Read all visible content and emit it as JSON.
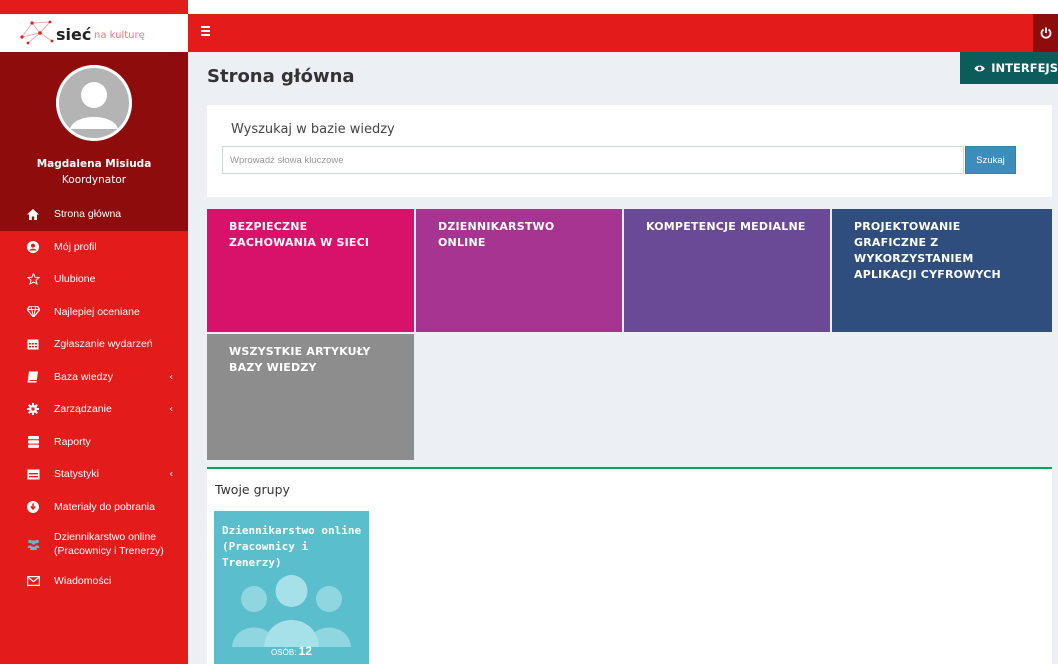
{
  "brand": {
    "logo_main": "sieć",
    "logo_sub": "na kulturę",
    "colors": {
      "primary_red": "#e31b1b",
      "dark_red": "#8f0c0c",
      "teal": "#0a5d5a",
      "blue": "#3c8dbc",
      "green": "#00a65a"
    }
  },
  "user": {
    "name": "Magdalena Misiuda",
    "role": "Koordynator"
  },
  "sidebar": {
    "items": [
      {
        "label": "Strona główna",
        "icon": "home-icon",
        "active": true
      },
      {
        "label": "Mój profil",
        "icon": "user-circle-icon"
      },
      {
        "label": "Ulubione",
        "icon": "star-icon"
      },
      {
        "label": "Najlepiej oceniane",
        "icon": "diamond-icon"
      },
      {
        "label": "Zgłaszanie wydarzeń",
        "icon": "calendar-icon"
      },
      {
        "label": "Baza wiedzy",
        "icon": "book-icon",
        "arrow": "‹"
      },
      {
        "label": "Zarządzanie",
        "icon": "gear-icon",
        "arrow": "‹"
      },
      {
        "label": "Raporty",
        "icon": "database-icon"
      },
      {
        "label": "Statystyki",
        "icon": "table-icon",
        "arrow": "‹"
      },
      {
        "label": "Materiały do pobrania",
        "icon": "download-circle-icon"
      },
      {
        "label_line1": "Dziennikarstwo online",
        "label_line2": "(Pracownicy i Trenerzy)",
        "icon": "users-icon"
      },
      {
        "label": "Wiadomości",
        "icon": "envelope-icon"
      }
    ]
  },
  "topbar": {
    "menu_icon": "hamburger-icon",
    "power_icon": "power-icon"
  },
  "header": {
    "title": "Strona główna",
    "interface_button": "INTERFEJS"
  },
  "search": {
    "label": "Wyszukaj w bazie wiedzy",
    "placeholder": "Wprowadź słowa kluczowe",
    "button": "Szukaj"
  },
  "tiles": [
    {
      "title": "BEZPIECZNE ZACHOWANIA W SIECI",
      "color": "#d8116a"
    },
    {
      "title": "DZIENNIKARSTWO ONLINE",
      "color": "#a63491"
    },
    {
      "title": "KOMPETENCJE MEDIALNE",
      "color": "#6a4a97"
    },
    {
      "title": "PROJEKTOWANIE GRAFICZNE Z WYKORZYSTANIEM APLIKACJI CYFROWYCH",
      "color": "#2f4e7d"
    },
    {
      "title": "WSZYSTKIE ARTYKUŁY BAZY WIEDZY",
      "color": "#8d8d8d"
    }
  ],
  "groups": {
    "title": "Twoje grupy",
    "cards": [
      {
        "name": "Dziennikarstwo online (Pracownicy i Trenerzy)",
        "count_label": "OSÓB:",
        "count": "12",
        "color": "#5bbecd"
      }
    ]
  }
}
